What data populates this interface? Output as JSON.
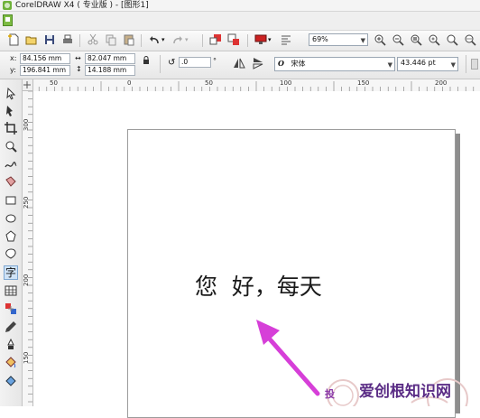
{
  "window": {
    "title": "CorelDRAW X4 ( 专业版 ) - [图形1]"
  },
  "toolbar": {
    "zoom": "69%",
    "icons": [
      "new-icon",
      "open-icon",
      "save-icon",
      "print-icon",
      "cut-icon",
      "copy-icon",
      "paste-icon",
      "undo-icon",
      "redo-icon",
      "import-icon",
      "export-icon",
      "application-launcher-icon",
      "welcome-icon",
      "zoom-in-icon",
      "zoom-out-icon",
      "zoom-selected-icon",
      "zoom-all-icon",
      "zoom-page-icon"
    ]
  },
  "property_bar": {
    "x_label": "x:",
    "x_value": "84.156 mm",
    "y_label": "y:",
    "y_value": "196.841 mm",
    "width_value": "82.047 mm",
    "height_value": "14.188 mm",
    "rotation_value": ".0",
    "degree_symbol": "°",
    "font_style_glyph": "O",
    "font_name": "宋体",
    "font_size": "43.446 pt"
  },
  "rulers": {
    "top_labels": [
      "50",
      "0",
      "50",
      "100",
      "150",
      "200"
    ],
    "left_labels": [
      "300",
      "250",
      "200",
      "150"
    ]
  },
  "toolbox": {
    "tools": [
      "pick-tool-icon",
      "shape-tool-icon",
      "crop-tool-icon",
      "zoom-tool-icon",
      "freehand-tool-icon",
      "smart-fill-tool-icon",
      "rectangle-tool-icon",
      "ellipse-tool-icon",
      "polygon-tool-icon",
      "basic-shapes-tool-icon",
      "text-tool-icon",
      "table-tool-icon",
      "interactive-blend-tool-icon",
      "eyedropper-tool-icon",
      "outline-tool-icon",
      "fill-tool-icon",
      "interactive-fill-tool-icon"
    ],
    "text_tool_glyph": "字"
  },
  "canvas": {
    "text": "您  好，每天"
  },
  "watermark": {
    "site": "爱创根知识网",
    "partial_char": "投"
  },
  "colors": {
    "arrow": "#d63fd8",
    "accent": "#cfe3f7",
    "watermark": "#5b2d86"
  }
}
